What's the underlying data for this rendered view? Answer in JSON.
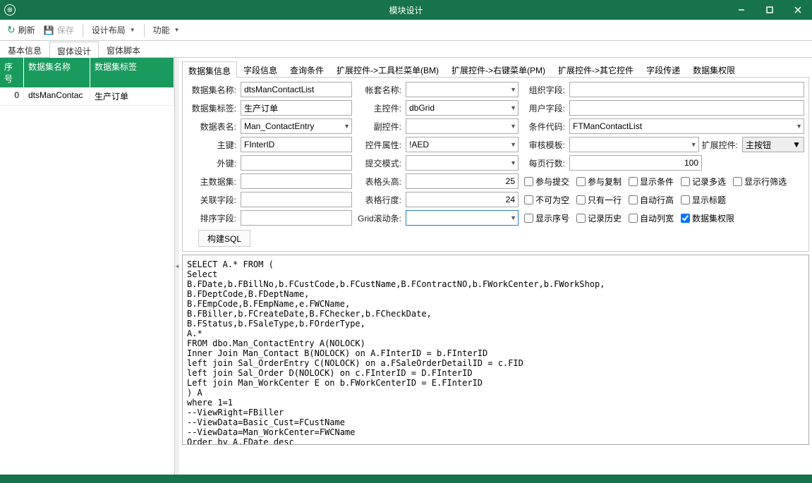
{
  "window": {
    "title": "模块设计"
  },
  "toolbar": {
    "refresh": "刷新",
    "save": "保存",
    "layout": "设计布局",
    "func": "功能"
  },
  "tabs1": [
    "基本信息",
    "窗体设计",
    "窗体脚本"
  ],
  "left_table": {
    "headers": [
      "序号",
      "数据集名称",
      "数据集标签"
    ],
    "row": {
      "seq": "0",
      "name": "dtsManContac",
      "label": "生产订单"
    }
  },
  "tabs2": [
    "数据集信息",
    "字段信息",
    "查询条件",
    "扩展控件->工具栏菜单(BM)",
    "扩展控件->右键菜单(PM)",
    "扩展控件->其它控件",
    "字段传递",
    "数据集权限"
  ],
  "form": {
    "ds_name_lbl": "数据集名称:",
    "ds_name_val": "dtsManContactList",
    "book_name_lbl": "帐套名称:",
    "book_name_val": "",
    "org_field_lbl": "组织字段:",
    "org_field_val": "",
    "ds_label_lbl": "数据集标签:",
    "ds_label_val": "生产订单",
    "main_ctrl_lbl": "主控件:",
    "main_ctrl_val": "dbGrid",
    "user_field_lbl": "用户字段:",
    "user_field_val": "",
    "table_name_lbl": "数据表名:",
    "table_name_val": "Man_ContactEntry",
    "sub_ctrl_lbl": "副控件:",
    "sub_ctrl_val": "",
    "cond_code_lbl": "条件代码:",
    "cond_code_val": "FTManContactList",
    "pk_lbl": "主键:",
    "pk_val": "FInterID",
    "ctrl_attr_lbl": "控件属性:",
    "ctrl_attr_val": "!AED",
    "audit_tpl_lbl": "审核模板:",
    "audit_tpl_val": "",
    "ext_ctrl_lbl": "扩展控件:",
    "ext_ctrl_val": "主按钮",
    "fk_lbl": "外键:",
    "fk_val": "",
    "submit_mode_lbl": "提交模式:",
    "submit_mode_val": "",
    "page_rows_lbl": "每页行数:",
    "page_rows_val": "100",
    "main_ds_lbl": "主数据集:",
    "main_ds_val": "",
    "head_h_lbl": "表格头高:",
    "head_h_val": "25",
    "rel_field_lbl": "关联字段:",
    "rel_field_val": "",
    "row_h_lbl": "表格行度:",
    "row_h_val": "24",
    "sort_field_lbl": "排序字段:",
    "sort_field_val": "",
    "scroll_lbl": "Grid滚动条:",
    "scroll_val": ""
  },
  "checks": {
    "c1": "参与提交",
    "c2": "参与复制",
    "c3": "显示条件",
    "c4": "记录多选",
    "c5": "显示行筛选",
    "c6": "不可为空",
    "c7": "只有一行",
    "c8": "自动行高",
    "c9": "显示标题",
    "c10": "显示序号",
    "c11": "记录历史",
    "c12": "自动列宽",
    "c13": "数据集权限"
  },
  "build_sql_btn": "构建SQL",
  "sql": "SELECT A.* FROM (\nSelect\nB.FDate,b.FBillNo,b.FCustCode,b.FCustName,B.FContractNO,b.FWorkCenter,b.FWorkShop,\nB.FDeptCode,B.FDeptName,\nB.FEmpCode,B.FEmpName,e.FWCName,\nB.FBiller,b.FCreateDate,B.FChecker,b.FCheckDate,\nB.FStatus,b.FSaleType,b.FOrderType,\nA.*\nFROM dbo.Man_ContactEntry A(NOLOCK)\nInner Join Man_Contact B(NOLOCK) on A.FInterID = b.FInterID\nleft join Sal_OrderEntry C(NOLOCK) on a.FSaleOrderDetailID = c.FID\nleft join Sal_Order D(NOLOCK) on c.FInterID = D.FInterID\nLeft join Man_WorkCenter E on b.FWorkCenterID = E.FInterID\n) A\nwhere 1=1\n--ViewRight=FBiller\n--ViewData=Basic_Cust=FCustName\n--ViewData=Man_WorkCenter=FWCName\nOrder by A.FDate desc"
}
